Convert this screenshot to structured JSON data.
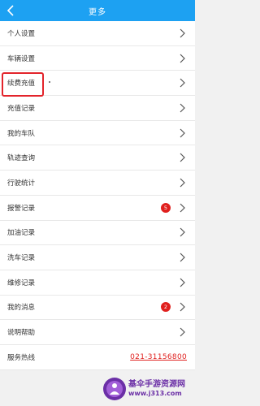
{
  "header": {
    "title": "更多"
  },
  "menu": [
    {
      "label": "个人设置"
    },
    {
      "label": "车辆设置"
    },
    {
      "label": "续费充值"
    },
    {
      "label": "充值记录"
    },
    {
      "label": "我的车队"
    },
    {
      "label": "轨迹查询"
    },
    {
      "label": "行驶统计"
    },
    {
      "label": "报警记录",
      "badge": "5"
    },
    {
      "label": "加油记录"
    },
    {
      "label": "洗车记录"
    },
    {
      "label": "维修记录"
    },
    {
      "label": "我的消息",
      "badge": "2"
    },
    {
      "label": "说明帮助"
    }
  ],
  "hotline": {
    "label": "服务热线",
    "number": "021-31156800"
  },
  "watermark": {
    "line1": "基伞手游资源网",
    "line2": "www.j313.com"
  },
  "colors": {
    "header": "#1da1f2",
    "badge": "#e0201e",
    "highlight": "#e3242b"
  },
  "icons": {
    "back": "chevron-left-icon",
    "row": "chevron-right-icon"
  }
}
